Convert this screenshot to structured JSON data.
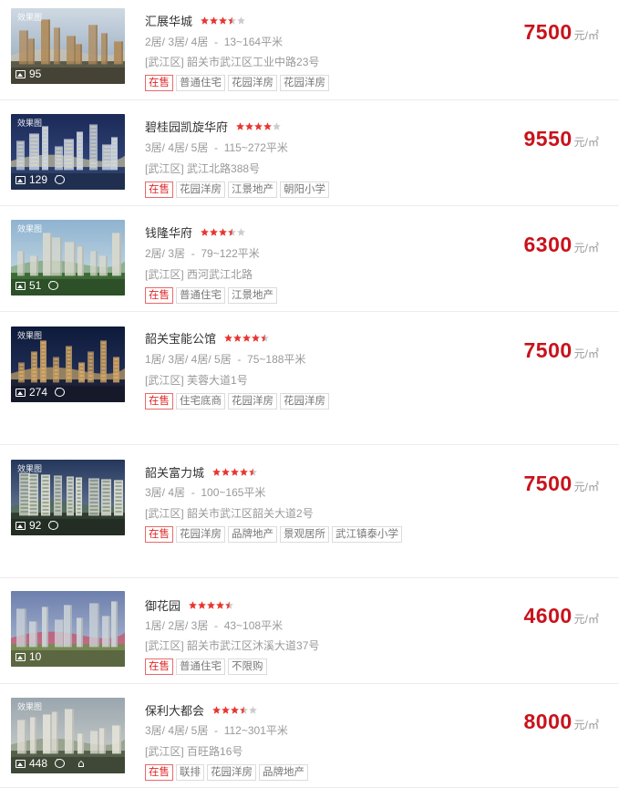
{
  "listings": [
    {
      "name": "汇展华城",
      "rating": 3.5,
      "layout": "2居/ 3居/ 4居",
      "area": "13~164平米",
      "district": "[武江区]",
      "address": "韶关市武江区工业中路23号",
      "status": "在售",
      "tags": [
        "普通住宅",
        "花园洋房",
        "花园洋房"
      ],
      "price": "7500",
      "unit": "元/㎡",
      "photos": "95",
      "effect_label": "效果图",
      "chat": false,
      "panorama": false
    },
    {
      "name": "碧桂园凯旋华府",
      "rating": 4,
      "layout": "3居/ 4居/ 5居",
      "area": "115~272平米",
      "district": "[武江区]",
      "address": "武江北路388号",
      "status": "在售",
      "tags": [
        "花园洋房",
        "江景地产",
        "朝阳小学"
      ],
      "price": "9550",
      "unit": "元/㎡",
      "photos": "129",
      "effect_label": "效果图",
      "chat": true,
      "panorama": false
    },
    {
      "name": "钱隆华府",
      "rating": 3.5,
      "layout": "2居/ 3居",
      "area": "79~122平米",
      "district": "[武江区]",
      "address": "西河武江北路",
      "status": "在售",
      "tags": [
        "普通住宅",
        "江景地产"
      ],
      "price": "6300",
      "unit": "元/㎡",
      "photos": "51",
      "effect_label": "效果图",
      "chat": true,
      "panorama": false
    },
    {
      "name": "韶关宝能公馆",
      "rating": 4.5,
      "layout": "1居/ 3居/ 4居/ 5居",
      "area": "75~188平米",
      "district": "[武江区]",
      "address": "芙蓉大道1号",
      "status": "在售",
      "tags": [
        "住宅底商",
        "花园洋房",
        "花园洋房"
      ],
      "price": "7500",
      "unit": "元/㎡",
      "photos": "274",
      "effect_label": "效果图",
      "chat": true,
      "panorama": false
    },
    {
      "name": "韶关富力城",
      "rating": 4.5,
      "layout": "3居/ 4居",
      "area": "100~165平米",
      "district": "[武江区]",
      "address": "韶关市武江区韶关大道2号",
      "status": "在售",
      "tags": [
        "花园洋房",
        "品牌地产",
        "景观居所",
        "武江镇泰小学"
      ],
      "price": "7500",
      "unit": "元/㎡",
      "photos": "92",
      "effect_label": "效果图",
      "chat": true,
      "panorama": false
    },
    {
      "name": "御花园",
      "rating": 4.5,
      "layout": "1居/ 2居/ 3居",
      "area": "43~108平米",
      "district": "[武江区]",
      "address": "韶关市武江区沐溪大道37号",
      "status": "在售",
      "tags": [
        "普通住宅",
        "不限购"
      ],
      "price": "4600",
      "unit": "元/㎡",
      "photos": "10",
      "effect_label": "",
      "chat": false,
      "panorama": false
    },
    {
      "name": "保利大都会",
      "rating": 3.5,
      "layout": "3居/ 4居/ 5居",
      "area": "112~301平米",
      "district": "[武江区]",
      "address": "百旺路16号",
      "status": "在售",
      "tags": [
        "联排",
        "花园洋房",
        "品牌地产"
      ],
      "price": "8000",
      "unit": "元/㎡",
      "photos": "448",
      "effect_label": "效果图",
      "chat": true,
      "panorama": true
    }
  ],
  "colors": {
    "price": "#c9121b",
    "star": "#e8352f",
    "star_empty": "#cccccc",
    "sale_tag": "#e02828"
  }
}
